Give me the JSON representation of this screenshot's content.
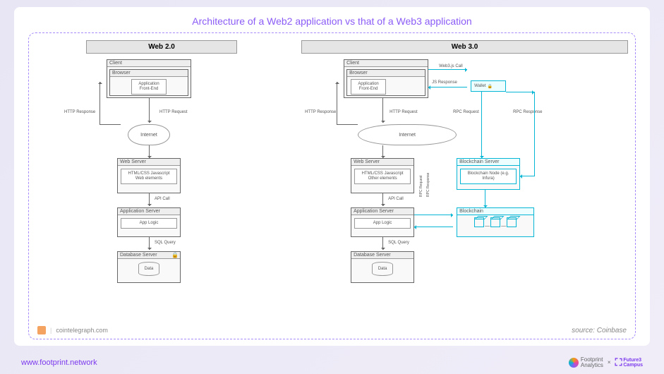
{
  "title": "Architecture of a Web2 application vs that of a Web3 application",
  "web2": {
    "header": "Web 2.0",
    "client": "Client",
    "browser": "Browser",
    "frontend": "Application\nFront-End",
    "http_response": "HTTP Response",
    "http_request": "HTTP Request",
    "internet": "Internet",
    "web_server": "Web Server",
    "web_server_content": "HTML/CSS\nJavascript\nWeb elements",
    "api_call": "API Call",
    "app_server": "Application Server",
    "app_logic": "App Logic",
    "sql_query": "SQL Query",
    "db_server": "Database Server",
    "data": "Data"
  },
  "web3": {
    "header": "Web 3.0",
    "client": "Client",
    "browser": "Browser",
    "frontend": "Application\nFront-End",
    "web3js_call": "Web3.js Call",
    "js_response": "JS Response",
    "wallet": "Wallet",
    "http_response": "HTTP Response",
    "http_request": "HTTP Request",
    "rpc_request": "RPC Request",
    "rpc_response": "RPC Response",
    "internet": "Internet",
    "web_server": "Web Server",
    "web_server_content": "HTML/CSS\nJavascript\nOther elements",
    "api_call": "API Call",
    "app_server": "Application Server",
    "app_logic": "App Logic",
    "sql_query": "SQL Query",
    "db_server": "Database Server",
    "data": "Data",
    "blockchain_server": "Blockchain Server",
    "blockchain_node": "Blockchain Node\n(e.g. Infura)",
    "blockchain": "Blockchain"
  },
  "attribution": "cointelegraph.com",
  "source_label": "source: ",
  "source_value": "Coinbase",
  "footer_url": "www.footprint.network",
  "footnote_x": "×",
  "logo_fp": "Footprint\nAnalytics",
  "logo_f3": "Future3\nCampus"
}
